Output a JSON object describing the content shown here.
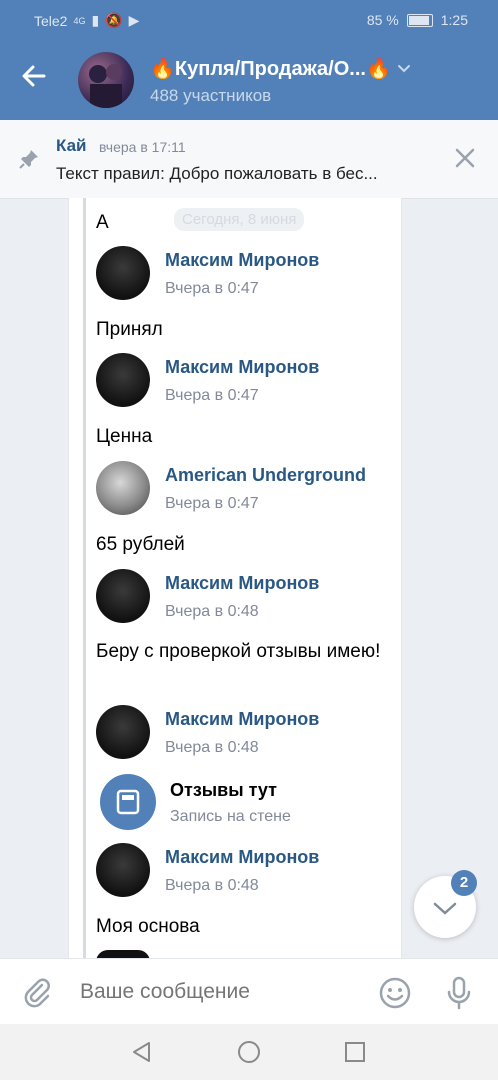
{
  "status_bar": {
    "carrier": "Tele2",
    "network": "4G",
    "battery": "85 %",
    "time": "1:25"
  },
  "header": {
    "title": "🔥Купля/Продажа/О...🔥",
    "members": "488 участников"
  },
  "pinned": {
    "author": "Кай",
    "time": "вчера в 17:11",
    "text": "Текст правил: Добро пожаловать в бес..."
  },
  "date_divider": "Сегодня, 8 июня",
  "messages": [
    {
      "type": "text",
      "text": "А"
    },
    {
      "type": "author",
      "name": "Максим Миронов",
      "time": "Вчера в 0:47",
      "avatar": "dark"
    },
    {
      "type": "text",
      "text": "Принял"
    },
    {
      "type": "author",
      "name": "Максим Миронов",
      "time": "Вчера в 0:47",
      "avatar": "dark"
    },
    {
      "type": "text",
      "text": "Ценна"
    },
    {
      "type": "author",
      "name": "American Underground",
      "time": "Вчера в 0:47",
      "avatar": "light"
    },
    {
      "type": "text",
      "text": "65 рублей"
    },
    {
      "type": "author",
      "name": "Максим Миронов",
      "time": "Вчера в 0:48",
      "avatar": "dark"
    },
    {
      "type": "text",
      "text": "Беру с проверкой отзывы имею!"
    },
    {
      "type": "author",
      "name": "Максим Миронов",
      "time": "Вчера в 0:48",
      "avatar": "dark"
    },
    {
      "type": "attachment",
      "title": "Отзывы тут",
      "subtitle": "Запись на стене"
    },
    {
      "type": "author",
      "name": "Максим Миронов",
      "time": "Вчера в 0:48",
      "avatar": "dark"
    },
    {
      "type": "text",
      "text": "Моя основа"
    }
  ],
  "scroll_down": {
    "badge": "2"
  },
  "composer": {
    "placeholder": "Ваше сообщение"
  },
  "icons": {
    "back": "arrow-left-icon",
    "pin": "pin-icon",
    "close": "close-icon",
    "attach": "paperclip-icon",
    "emoji": "smile-icon",
    "mic": "microphone-icon",
    "scroll": "chevron-down-icon"
  },
  "colors": {
    "brand": "#5181b8",
    "link": "#2a5885",
    "muted": "#828a99"
  }
}
